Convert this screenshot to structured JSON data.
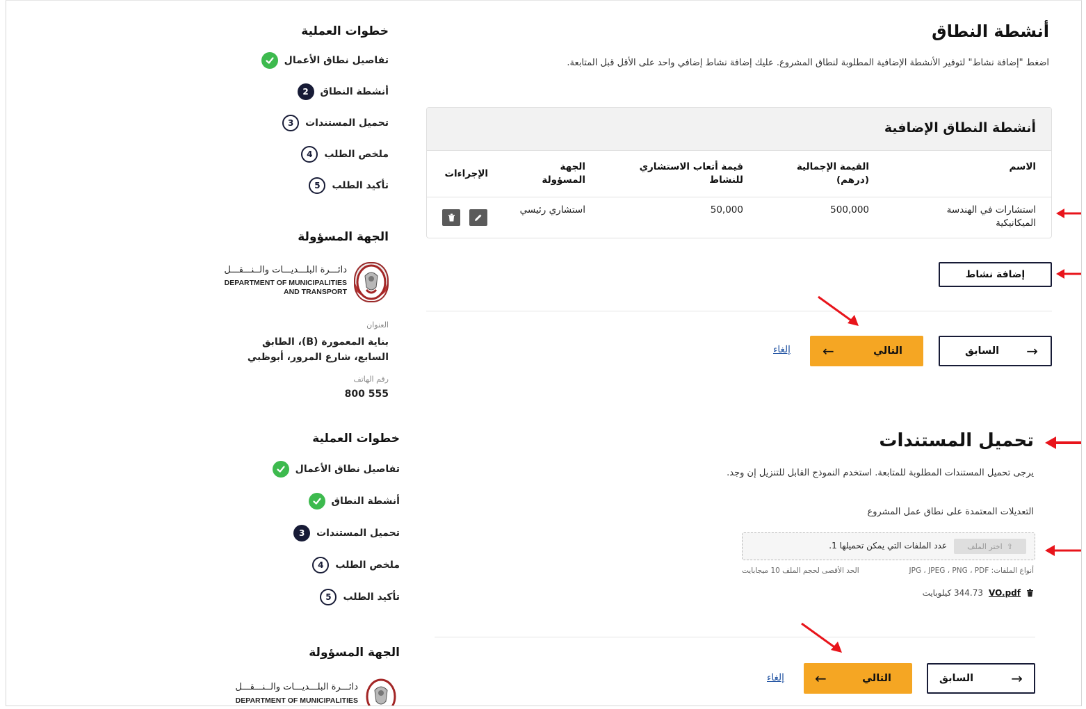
{
  "sidebar1": {
    "title": "خطوات العملية",
    "steps": [
      {
        "label": "تفاصيل نطاق الأعمال",
        "state": "done",
        "num": ""
      },
      {
        "label": "أنشطة النطاق",
        "state": "current",
        "num": "2"
      },
      {
        "label": "تحميل المستندات",
        "state": "todo",
        "num": "3"
      },
      {
        "label": "ملخص الطلب",
        "state": "todo",
        "num": "4"
      },
      {
        "label": "تأكيد الطلب",
        "state": "todo",
        "num": "5"
      }
    ],
    "authority_title": "الجهة المسؤولة",
    "logo_ar": "دائـــرة البلـــديـــات والــنـــقـــل",
    "logo_en_1": "DEPARTMENT OF MUNICIPALITIES",
    "logo_en_2": "AND TRANSPORT",
    "address_label": "العنوان",
    "address_1": "بناية المعمورة (B)، الطابق",
    "address_2": "السابع، شارع المرور، أبوظبي",
    "phone_label": "رقم الهاتف",
    "phone": "800 555"
  },
  "sidebar2": {
    "title": "خطوات العملية",
    "steps": [
      {
        "label": "تفاصيل نطاق الأعمال",
        "state": "done",
        "num": ""
      },
      {
        "label": "أنشطة النطاق",
        "state": "done",
        "num": ""
      },
      {
        "label": "تحميل المستندات",
        "state": "current",
        "num": "3"
      },
      {
        "label": "ملخص الطلب",
        "state": "todo",
        "num": "4"
      },
      {
        "label": "تأكيد الطلب",
        "state": "todo",
        "num": "5"
      }
    ],
    "authority_title": "الجهة المسؤولة",
    "logo_ar": "دائـــرة البلـــديـــات والــنـــقـــل",
    "logo_en_1": "DEPARTMENT OF MUNICIPALITIES"
  },
  "activities": {
    "title": "أنشطة النطاق",
    "description": "اضغط \"إضافة نشاط\" لتوفير الأنشطة الإضافية المطلوبة لنطاق المشروع. عليك إضافة نشاط إضافي واحد على الأقل قبل المتابعة.",
    "table_title": "أنشطة النطاق الإضافية",
    "columns": {
      "name": "الاسم",
      "total_1": "القيمة الإجمالية",
      "total_2": "(درهم)",
      "fee_1": "قيمة أتعاب الاستشاري",
      "fee_2": "للنشاط",
      "party_1": "الجهة",
      "party_2": "المسؤولة",
      "actions": "الإجراءات"
    },
    "rows": [
      {
        "name_1": "استشارات في الهندسة",
        "name_2": "الميكانيكية",
        "total": "500,000",
        "fee": "50,000",
        "party": "استشاري رئيسي"
      }
    ],
    "add_button": "إضافة نشاط",
    "next_label": "التالي",
    "prev_label": "السابق",
    "cancel_label": "إلغاء"
  },
  "documents": {
    "title": "تحميل المستندات",
    "description": "يرجى تحميل المستندات المطلوبة للمتابعة. استخدم النموذج القابل للتنزيل إن وجد.",
    "field_label": "التعديلات المعتمدة على نطاق عمل المشروع",
    "choose_file": "اختر الملف",
    "files_count_text": "عدد الملفات التي يمكن تحميلها 1.",
    "file_types": "أنواع الملفات: JPG ، JPEG ، PNG ، PDF",
    "max_size": "الحد الأقصى لحجم الملف 10 ميجابايت",
    "file_name": "VO.pdf",
    "file_size": "344.73 كيلوبايت",
    "next_label": "التالي",
    "prev_label": "السابق",
    "cancel_label": "إلغاء"
  },
  "colors": {
    "accent": "#f5a623",
    "navy": "#171b36",
    "success": "#3dba4e",
    "annotation_arrow": "#e8141b"
  }
}
